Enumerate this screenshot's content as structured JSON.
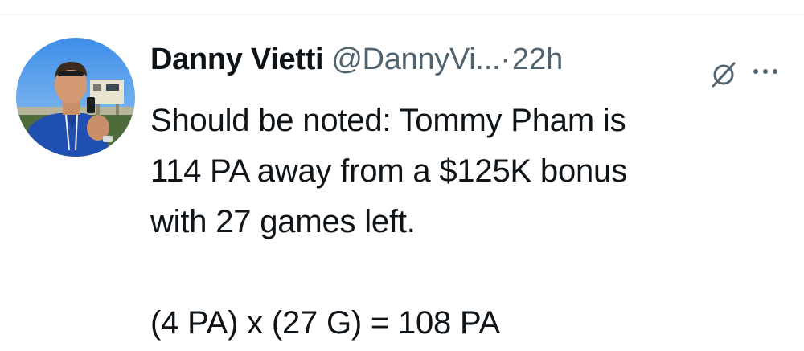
{
  "tweet": {
    "author": {
      "display_name": "Danny Vietti",
      "handle": "@DannyVi...",
      "avatar": "profile-photo"
    },
    "separator": "·",
    "timestamp": "22h",
    "icons": {
      "grok": "grok-icon",
      "more": "more-options-icon"
    },
    "text_lines": [
      "Should be noted: Tommy Pham is",
      "114 PA away from a $125K bonus",
      "with 27 games left.",
      "(4 PA) x (27 G) = 108 PA"
    ]
  },
  "colors": {
    "text_primary": "#0f1419",
    "text_secondary": "#536471",
    "divider": "#eff3f4"
  }
}
